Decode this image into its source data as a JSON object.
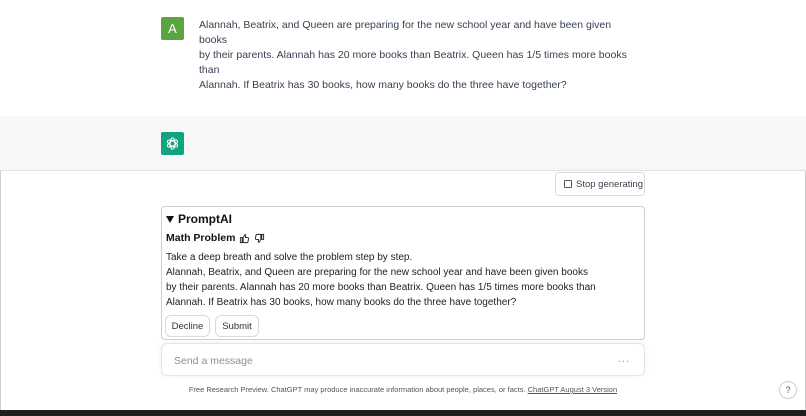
{
  "user_message": {
    "avatar_letter": "A",
    "lines": [
      "Alannah, Beatrix, and Queen are preparing for the new school year and have been given",
      "books",
      "by their parents. Alannah has 20 more books than Beatrix. Queen has 1/5 times more books",
      "than",
      "Alannah. If Beatrix has 30 books, how many books do the three have together?"
    ]
  },
  "assistant": {
    "avatar_icon": "openai-logo-icon"
  },
  "stop_button": {
    "label": "Stop generating"
  },
  "prompt_card": {
    "title": "PromptAI",
    "subtitle": "Math Problem",
    "body_lines": [
      "Take a deep breath and solve the problem step by step.",
      "Alannah, Beatrix, and Queen are preparing for the new school year and have been given books",
      "by their parents. Alannah has 20 more books than Beatrix. Queen has 1/5 times more books than",
      "Alannah. If Beatrix has 30 books, how many books do the three have together?"
    ],
    "decline_label": "Decline",
    "submit_label": "Submit"
  },
  "composer": {
    "placeholder": "Send a message",
    "value": "",
    "dots": "..."
  },
  "footer": {
    "text": "Free Research Preview. ChatGPT may produce inaccurate information about people, places, or facts.",
    "link": "ChatGPT August 3 Version"
  },
  "help": {
    "label": "?"
  },
  "colors": {
    "user_avatar": "#5aa542",
    "bot_avatar": "#10a37f",
    "assistant_bg": "#f7f7f8"
  }
}
